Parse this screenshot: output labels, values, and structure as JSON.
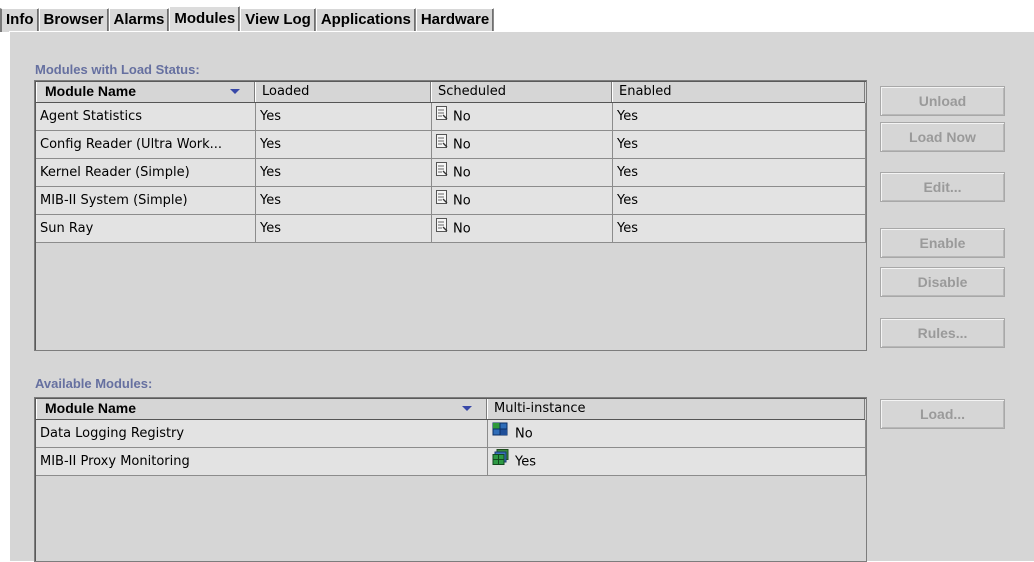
{
  "tabs": [
    "Info",
    "Browser",
    "Alarms",
    "Modules",
    "View Log",
    "Applications",
    "Hardware"
  ],
  "active_tab": "Modules",
  "loaded": {
    "title": "Modules with Load Status:",
    "columns": [
      "Module Name",
      "Loaded",
      "Scheduled",
      "Enabled"
    ],
    "rows": [
      [
        "Agent Statistics",
        "Yes",
        "No",
        "Yes"
      ],
      [
        "Config Reader (Ultra Work...",
        "Yes",
        "No",
        "Yes"
      ],
      [
        "Kernel Reader (Simple)",
        "Yes",
        "No",
        "Yes"
      ],
      [
        "MIB-II System (Simple)",
        "Yes",
        "No",
        "Yes"
      ],
      [
        "Sun Ray",
        "Yes",
        "No",
        "Yes"
      ]
    ]
  },
  "available": {
    "title": "Available Modules:",
    "columns": [
      "Module Name",
      "Multi-instance"
    ],
    "rows": [
      [
        "Data Logging Registry",
        "No"
      ],
      [
        "MIB-II Proxy Monitoring",
        "Yes"
      ]
    ]
  },
  "buttons": {
    "unload": "Unload",
    "load_now": "Load Now",
    "edit": "Edit...",
    "enable": "Enable",
    "disable": "Disable",
    "rules": "Rules...",
    "load": "Load..."
  },
  "icons": {
    "scheduled": "schedule-document-icon",
    "single_instance": "single-instance-module-icon",
    "multi_instance": "multi-instance-module-icon"
  },
  "colors": {
    "section_label": "#6670a0",
    "sort_arrow": "#3848a8",
    "disabled_text": "#9a9a9a"
  }
}
